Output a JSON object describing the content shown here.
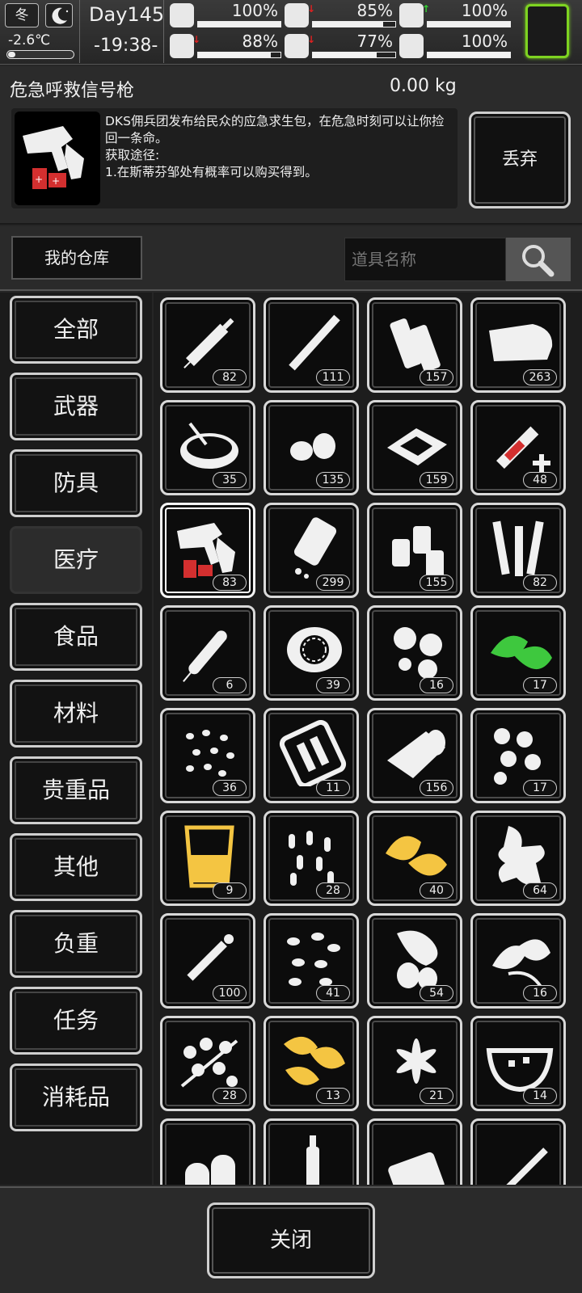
{
  "status": {
    "season": "冬",
    "weather_icon": "snow-icon",
    "night_icon": "moon-icon",
    "temperature": "-2.6℃",
    "temperature_level": 0.05,
    "day": "Day145",
    "time": "-19:38-",
    "stats": [
      {
        "icon": "health-kit-icon",
        "value": "100%",
        "level": 1.0,
        "trend": ""
      },
      {
        "icon": "stomach-icon",
        "value": "85%",
        "level": 0.85,
        "trend": "down"
      },
      {
        "icon": "bladder-icon",
        "value": "100%",
        "level": 1.0,
        "trend": "up"
      },
      {
        "icon": "boot-icon",
        "value": "88%",
        "level": 0.88,
        "trend": "down"
      },
      {
        "icon": "water-drop-icon",
        "value": "77%",
        "level": 0.77,
        "trend": "down"
      },
      {
        "icon": "heart-icon",
        "value": "100%",
        "level": 1.0,
        "trend": ""
      }
    ],
    "accent": "#7ed321"
  },
  "detail": {
    "name": "危急呼救信号枪",
    "weight": "0.00 kg",
    "description": "DKS佣兵团发布给民众的应急求生包，在危急时刻可以让你捡回一条命。\n获取途径:\n1.在斯蒂芬邹处有概率可以购买得到。",
    "discard_label": "丢弃"
  },
  "storage_label": "我的仓库",
  "search": {
    "placeholder": "道具名称",
    "icon": "search-icon"
  },
  "categories": [
    {
      "label": "全部",
      "selected": false
    },
    {
      "label": "武器",
      "selected": false
    },
    {
      "label": "防具",
      "selected": false
    },
    {
      "label": "医疗",
      "selected": true
    },
    {
      "label": "食品",
      "selected": false
    },
    {
      "label": "材料",
      "selected": false
    },
    {
      "label": "贵重品",
      "selected": false
    },
    {
      "label": "其他",
      "selected": false
    },
    {
      "label": "负重",
      "selected": false
    },
    {
      "label": "任务",
      "selected": false
    },
    {
      "label": "消耗品",
      "selected": false
    }
  ],
  "items": [
    {
      "icon": "syringe-icon",
      "count": "82"
    },
    {
      "icon": "cigarette-icon",
      "count": "111"
    },
    {
      "icon": "bandage-roll-icon",
      "count": "157"
    },
    {
      "icon": "cloth-bandage-icon",
      "count": "263"
    },
    {
      "icon": "bowl-icon",
      "count": "35"
    },
    {
      "icon": "seeds-icon",
      "count": "135"
    },
    {
      "icon": "herb-tray-icon",
      "count": "159"
    },
    {
      "icon": "syringe-plus-icon",
      "count": "48"
    },
    {
      "icon": "flare-gun-icon",
      "count": "83",
      "selected": true
    },
    {
      "icon": "pill-bottle-icon",
      "count": "299"
    },
    {
      "icon": "spray-bottles-icon",
      "count": "155"
    },
    {
      "icon": "tubes-icon",
      "count": "82"
    },
    {
      "icon": "autoinjector-icon",
      "count": "6"
    },
    {
      "icon": "lemon-icon",
      "count": "39"
    },
    {
      "icon": "tablets-icon",
      "count": "16"
    },
    {
      "icon": "mint-leaf-icon",
      "count": "17"
    },
    {
      "icon": "small-pills-icon",
      "count": "36"
    },
    {
      "icon": "ampoule-box-icon",
      "count": "11"
    },
    {
      "icon": "gauze-roll-icon",
      "count": "156"
    },
    {
      "icon": "round-seeds-icon",
      "count": "17"
    },
    {
      "icon": "cup-icon",
      "count": "9"
    },
    {
      "icon": "capsules-icon",
      "count": "28"
    },
    {
      "icon": "yellow-leaf-icon",
      "count": "40"
    },
    {
      "icon": "ginger-root-icon",
      "count": "64"
    },
    {
      "icon": "thermometer-syringe-icon",
      "count": "100"
    },
    {
      "icon": "sprouts-icon",
      "count": "41"
    },
    {
      "icon": "root-plant-icon",
      "count": "54"
    },
    {
      "icon": "leaf-branch-icon",
      "count": "16"
    },
    {
      "icon": "berry-branch-icon",
      "count": "28"
    },
    {
      "icon": "yellow-herb-icon",
      "count": "13"
    },
    {
      "icon": "star-flower-icon",
      "count": "21"
    },
    {
      "icon": "ice-bowl-icon",
      "count": "14"
    },
    {
      "icon": "pill-pair-icon",
      "count": ""
    },
    {
      "icon": "bottle-icon",
      "count": ""
    },
    {
      "icon": "blister-pack-icon",
      "count": ""
    },
    {
      "icon": "scalpel-icon",
      "count": ""
    }
  ],
  "close_label": "关闭"
}
